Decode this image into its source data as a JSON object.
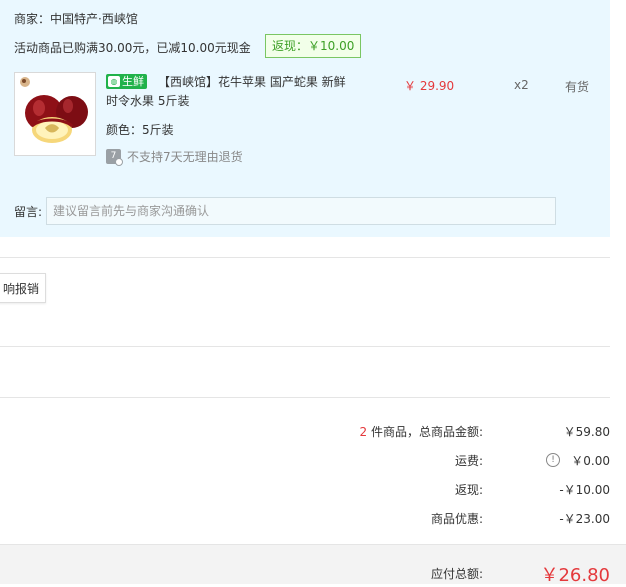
{
  "store": {
    "label": "商家：中国特产·西峡馆",
    "promo": "活动商品已购满30.00元，已减10.00元现金",
    "rebate_tag": "返现：￥10.00"
  },
  "item": {
    "fresh_badge": "生鲜",
    "title": "【西峡馆】花牛苹果 国产蛇果 新鲜时令水果 5斤装",
    "spec": "颜色：5斤装",
    "return_policy": "不支持7天无理由退货",
    "return_icon_text": "7",
    "price": "￥ 29.90",
    "quantity": "x2",
    "stock": "有货"
  },
  "note": {
    "label": "留言:",
    "placeholder": "建议留言前先与商家沟通确认"
  },
  "invoice": {
    "button": "响报销"
  },
  "summary": {
    "count": "2",
    "goods_label": " 件商品，总商品金额:",
    "goods_value": "￥59.80",
    "shipping_label": "运费:",
    "shipping_value": "￥0.00",
    "rebate_label": "返现:",
    "rebate_value": "-￥10.00",
    "discount_label": "商品优惠:",
    "discount_value": "-￥23.00",
    "total_label": "应付总额:",
    "total_value": "￥26.80"
  },
  "colors": {
    "accent_red": "#e4393c",
    "shipping_orange": "#ff6a00",
    "fresh_green": "#21b24b",
    "panel_blue": "#eaf8ff"
  }
}
